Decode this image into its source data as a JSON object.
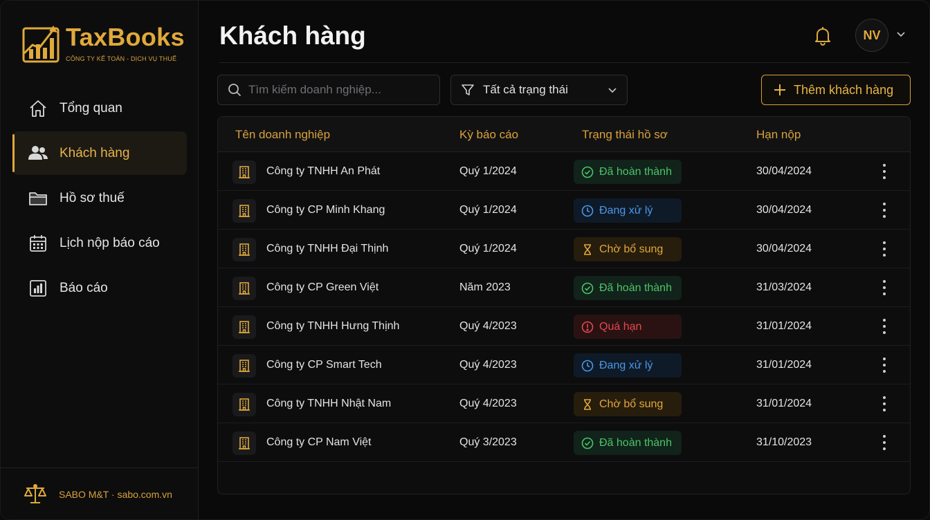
{
  "brand": {
    "title": "TaxBooks",
    "subtitle": "CÔNG TY KẾ TOÁN - DỊCH VỤ THUẾ",
    "accent": "#e0a93a"
  },
  "sidebar": {
    "items": [
      {
        "label": "Tổng quan",
        "icon": "home-icon",
        "active": false
      },
      {
        "label": "Khách hàng",
        "icon": "users-icon",
        "active": true
      },
      {
        "label": "Hồ sơ thuế",
        "icon": "folder-icon",
        "active": false
      },
      {
        "label": "Lịch nộp báo cáo",
        "icon": "calendar-icon",
        "active": false
      },
      {
        "label": "Báo cáo",
        "icon": "bar-chart-icon",
        "active": false
      }
    ],
    "footer": "SABO M&T · sabo.com.vn"
  },
  "header": {
    "title": "Khách hàng",
    "avatar_initials": "NV"
  },
  "toolbar": {
    "search_placeholder": "Tìm kiếm doanh nghiệp...",
    "filter_label": "Tất cả trạng thái",
    "add_label": "Thêm khách hàng"
  },
  "table": {
    "columns": [
      "Tên doanh nghiệp",
      "Kỳ báo cáo",
      "Trạng thái hồ sơ",
      "Hạn nộp"
    ],
    "rows": [
      {
        "name": "Công ty TNHH An Phát",
        "period": "Quý 1/2024",
        "status": "Đã hoàn thành",
        "status_type": "done",
        "due": "30/04/2024"
      },
      {
        "name": "Công ty CP Minh Khang",
        "period": "Quý 1/2024",
        "status": "Đang xử lý",
        "status_type": "processing",
        "due": "30/04/2024"
      },
      {
        "name": "Công ty TNHH Đại Thịnh",
        "period": "Quý 1/2024",
        "status": "Chờ bổ sung",
        "status_type": "pending",
        "due": "30/04/2024"
      },
      {
        "name": "Công ty CP Green Việt",
        "period": "Năm 2023",
        "status": "Đã hoàn thành",
        "status_type": "done",
        "due": "31/03/2024"
      },
      {
        "name": "Công ty TNHH Hưng Thịnh",
        "period": "Quý 4/2023",
        "status": "Quá hạn",
        "status_type": "overdue",
        "due": "31/01/2024"
      },
      {
        "name": "Công ty CP Smart Tech",
        "period": "Quý 4/2023",
        "status": "Đang xử lý",
        "status_type": "processing",
        "due": "31/01/2024"
      },
      {
        "name": "Công ty TNHH Nhật Nam",
        "period": "Quý 4/2023",
        "status": "Chờ bổ sung",
        "status_type": "pending",
        "due": "31/01/2024"
      },
      {
        "name": "Công ty CP Nam Việt",
        "period": "Quý 3/2023",
        "status": "Đã hoàn thành",
        "status_type": "done",
        "due": "31/10/2023"
      }
    ]
  },
  "status_colors": {
    "done": {
      "fg": "#4cc46a",
      "bg": "#11231a",
      "icon": "check-circle-icon"
    },
    "processing": {
      "fg": "#4a98e6",
      "bg": "#0f1a28",
      "icon": "clock-icon"
    },
    "pending": {
      "fg": "#e4a73a",
      "bg": "#261d0d",
      "icon": "hourglass-icon"
    },
    "overdue": {
      "fg": "#e5484d",
      "bg": "#2a1213",
      "icon": "alert-circle-icon"
    }
  }
}
